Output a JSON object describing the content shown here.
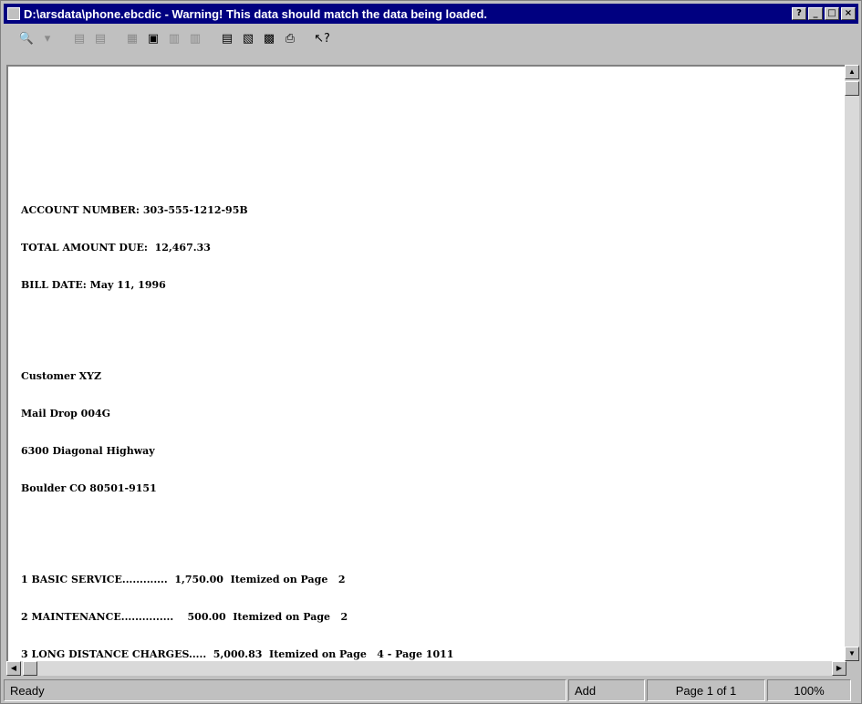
{
  "window": {
    "title": "D:\\arsdata\\phone.ebcdic  -  Warning!  This data should match the data being loaded.",
    "buttons": [
      "?",
      "_",
      "□",
      "×"
    ]
  },
  "toolbar": {
    "icons": [
      "find-icon",
      "next-icon",
      "prev-page-icon",
      "next-page-icon",
      "grid-icon",
      "view-icon",
      "columns-icon",
      "split-icon",
      "window-icon",
      "page-icon",
      "options-icon",
      "print-icon",
      "help-icon"
    ]
  },
  "document": {
    "lines": [
      "ACCOUNT NUMBER: 303-555-1212-95B",
      "TOTAL AMOUNT DUE:  12,467.33",
      "BILL DATE: May 11, 1996",
      "Customer XYZ",
      "Mail Drop 004G",
      "6300 Diagonal Highway",
      "Boulder CO 80501-9151",
      "1 BASIC SERVICE.............  1,750.00  Itemized on Page   2",
      "2 MAINTENANCE...............    500.00  Itemized on Page   2",
      "3 LONG DISTANCE CHARGES.....  5,000.83  Itemized on Page   4 - Page 1011"
    ]
  },
  "status": {
    "ready": "Ready",
    "mode": "Add",
    "page": "Page 1 of 1",
    "zoom": "100%"
  }
}
